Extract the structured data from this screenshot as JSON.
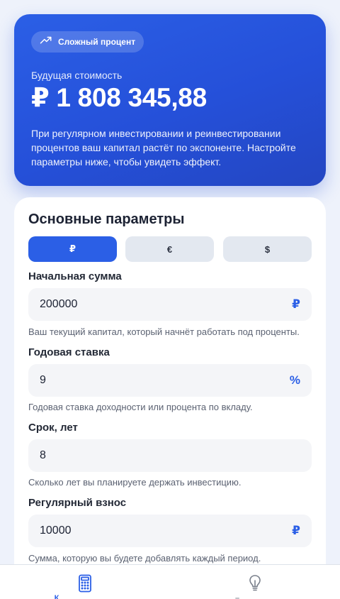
{
  "hero": {
    "badge_label": "Сложный процент",
    "subtitle": "Будущая стоимость",
    "value": "₽ 1 808 345,88",
    "description": "При регулярном инвестировании и реинвестировании процентов ваш капитал растёт по экспоненте. Настройте параметры ниже, чтобы увидеть эффект."
  },
  "params": {
    "title": "Основные параметры",
    "currency_options": [
      "₽",
      "€",
      "$"
    ],
    "selected_currency": "₽",
    "fields": [
      {
        "label": "Начальная сумма",
        "value": "200000",
        "suffix": "₽",
        "help": "Ваш текущий капитал, который начнёт работать под проценты."
      },
      {
        "label": "Годовая ставка",
        "value": "9",
        "suffix": "%",
        "help": "Годовая ставка доходности или процента по вкладу."
      },
      {
        "label": "Срок, лет",
        "value": "8",
        "suffix": "",
        "help": "Сколько лет вы планируете держать инвестицию."
      },
      {
        "label": "Регулярный взнос",
        "value": "10000",
        "suffix": "₽",
        "help": "Сумма, которую вы будете добавлять каждый период."
      }
    ]
  },
  "nav": {
    "items": [
      {
        "label": "К",
        "icon": "calculator-icon",
        "active": true
      },
      {
        "label": "–",
        "icon": "lightbulb-icon",
        "active": false
      }
    ]
  },
  "colors": {
    "accent": "#2b5fe6",
    "hero_gradient_start": "#2b5fe6",
    "hero_gradient_end": "#2446c2",
    "background": "#eef2fb"
  }
}
